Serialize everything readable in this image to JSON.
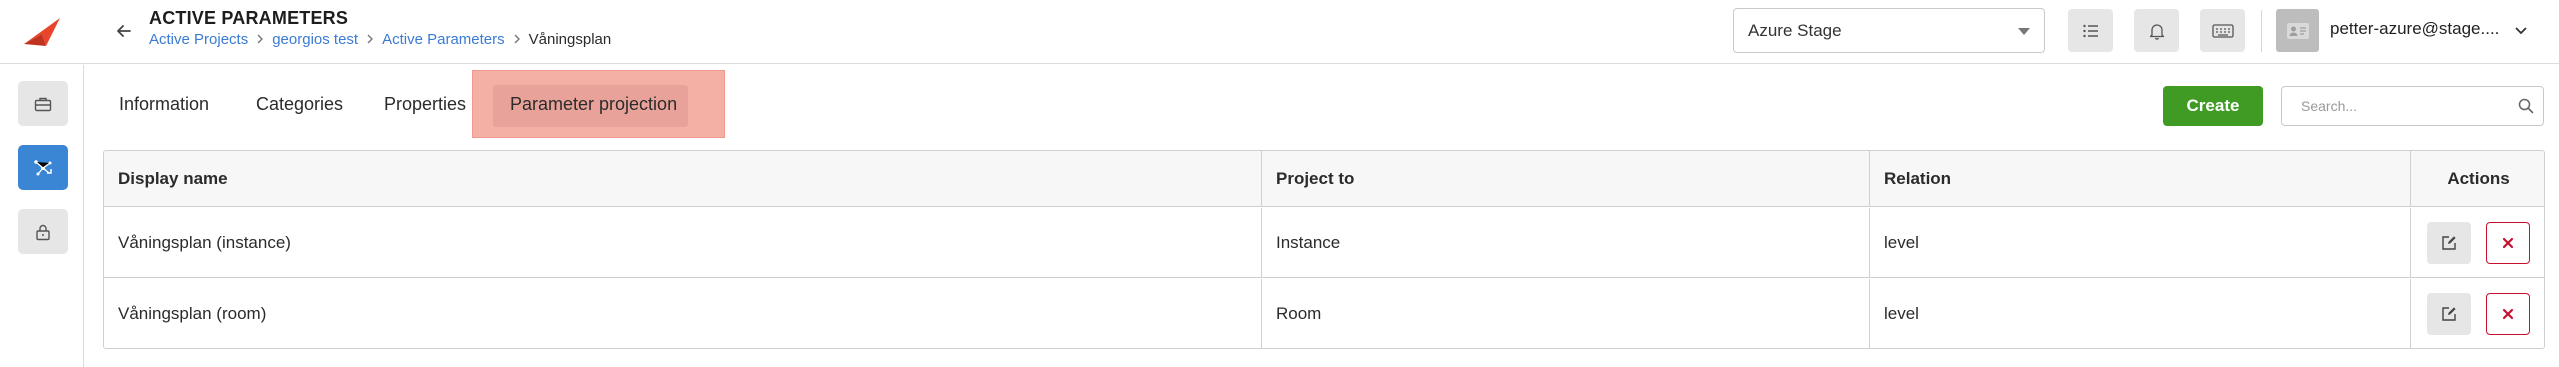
{
  "header": {
    "title": "ACTIVE PARAMETERS",
    "breadcrumb": [
      {
        "label": "Active Projects"
      },
      {
        "label": "georgios test"
      },
      {
        "label": "Active Parameters"
      },
      {
        "label": "Våningsplan"
      }
    ],
    "environment": {
      "selected": "Azure Stage"
    },
    "user": {
      "name": "petter-azure@stage...."
    },
    "icons": {
      "logo": "logo-icon",
      "back": "arrow-left-icon",
      "list": "list-icon",
      "bell": "bell-icon",
      "keyboard": "keyboard-icon",
      "avatar": "id-card-icon",
      "chevron": "chevron-down-icon"
    }
  },
  "sidebar": {
    "items": [
      {
        "icon": "briefcase-icon",
        "active": false
      },
      {
        "icon": "network-icon",
        "active": true
      },
      {
        "icon": "lock-icon",
        "active": false
      }
    ]
  },
  "tabs": [
    {
      "label": "Information",
      "active": false
    },
    {
      "label": "Categories",
      "active": false
    },
    {
      "label": "Properties",
      "active": false
    },
    {
      "label": "Parameter projection",
      "active": true
    }
  ],
  "toolbar": {
    "create_label": "Create",
    "search_placeholder": "Search..."
  },
  "table": {
    "columns": [
      "Display name",
      "Project to",
      "Relation",
      "Actions"
    ],
    "rows": [
      {
        "display_name": "Våningsplan (instance)",
        "project_to": "Instance",
        "relation": "level"
      },
      {
        "display_name": "Våningsplan (room)",
        "project_to": "Room",
        "relation": "level"
      }
    ]
  },
  "colors": {
    "accent_blue": "#3a86d4",
    "create_green": "#3f9b24",
    "delete_red": "#c8102e",
    "tab_highlight": "#f5b0a6",
    "logo_red": "#e8452c"
  }
}
